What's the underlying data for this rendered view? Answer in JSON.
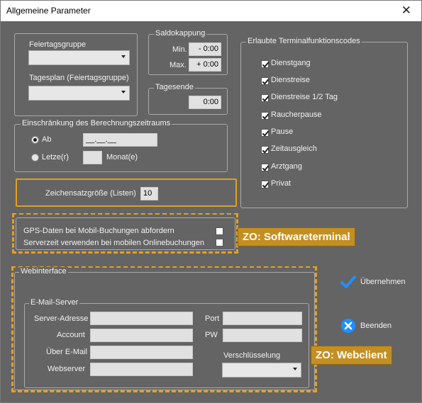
{
  "window": {
    "title": "Allgemeine Parameter"
  },
  "feiertag": {
    "group_label": "Feiertagsgruppe",
    "plan_label": "Tagesplan (Feiertagsgruppe)"
  },
  "saldo": {
    "label": "Saldokappung",
    "min_label": "Min.",
    "min_sign": "-",
    "min_value": "0:00",
    "max_label": "Max.",
    "max_sign": "+",
    "max_value": "0:00"
  },
  "tagesende": {
    "label": "Tagesende",
    "value": "0:00"
  },
  "terminal": {
    "label": "Erlaubte Terminalfunktionscodes",
    "items": [
      {
        "label": "Dienstgang",
        "checked": true
      },
      {
        "label": "Dienstreise",
        "checked": true
      },
      {
        "label": "Dienstreise 1/2 Tag",
        "checked": true
      },
      {
        "label": "Raucherpause",
        "checked": true
      },
      {
        "label": "Pause",
        "checked": true
      },
      {
        "label": "Zeitausgleich",
        "checked": true
      },
      {
        "label": "Arztgang",
        "checked": true
      },
      {
        "label": "Privat",
        "checked": true
      }
    ]
  },
  "einschraenkung": {
    "label": "Einschränkung des Berechnungszeitraums",
    "ab_label": "Ab",
    "ab_value": "__.__.__",
    "letzte_label": "Letze(r)",
    "monat_label": "Monat(e)"
  },
  "font": {
    "label": "Zeichensatzgröße (Listen)",
    "value": "10"
  },
  "gps": {
    "label": "GPS-Daten bei Mobil-Buchungen abfordern",
    "server_label": "Serverzeit verwenden bei mobilen Onlinebuchungen"
  },
  "tags": {
    "software": "ZO: Softwareterminal",
    "web": "ZO: Webclient"
  },
  "web": {
    "label": "Webinterface",
    "mail_label": "E-Mail-Server",
    "server_addr": "Server-Adresse",
    "port": "Port",
    "account": "Account",
    "pw": "PW",
    "ueber_mail": "Über E-Mail",
    "webserver": "Webserver",
    "encryption": "Verschlüsselung"
  },
  "buttons": {
    "apply": "Übernehmen",
    "quit": "Beenden"
  },
  "colors": {
    "background": "#646464",
    "accent": "#e6a11f",
    "check_blue": "#1e90ff"
  }
}
